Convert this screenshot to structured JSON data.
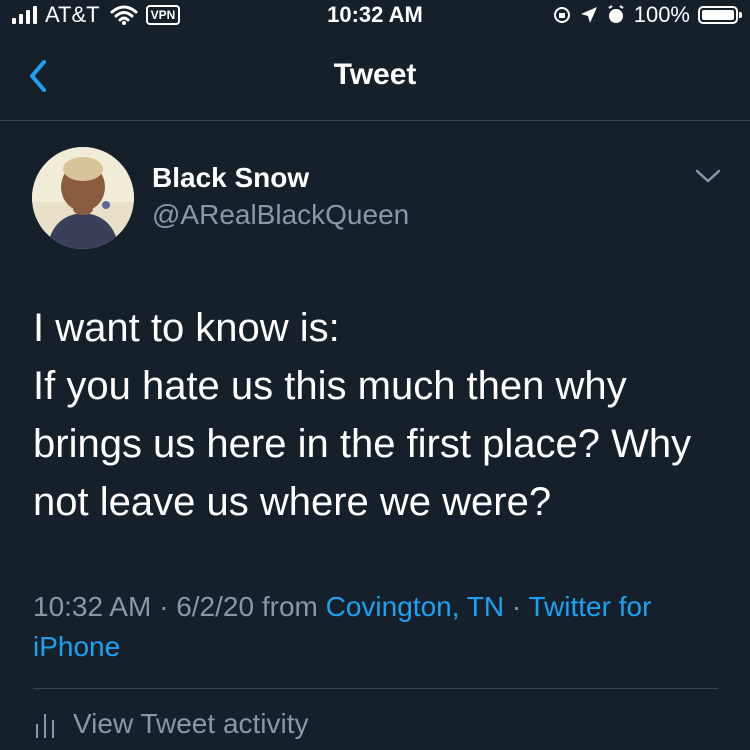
{
  "status_bar": {
    "carrier": "AT&T",
    "vpn": "VPN",
    "time": "10:32 AM",
    "battery": "100%",
    "icons": [
      "signal-icon",
      "wifi-icon",
      "vpn-icon",
      "orientation-lock-icon",
      "location-icon",
      "alarm-icon",
      "battery-icon"
    ]
  },
  "nav": {
    "title": "Tweet",
    "back_icon": "chevron-left-icon"
  },
  "tweet": {
    "display_name": "Black Snow",
    "handle": "@ARealBlackQueen",
    "text_lines": [
      "I want to know is:",
      "If you hate us this much then why brings us here in the first place? Why not leave us where we were?"
    ],
    "time": "10:32 AM",
    "separator": "·",
    "date": "6/2/20",
    "from_label": "from",
    "location": "Covington, TN",
    "source": "Twitter for iPhone",
    "activity_label": "View Tweet activity"
  },
  "colors": {
    "background": "#15202b",
    "accent": "#1da1f2",
    "secondary_text": "#8899a6",
    "divider": "#38444d"
  }
}
